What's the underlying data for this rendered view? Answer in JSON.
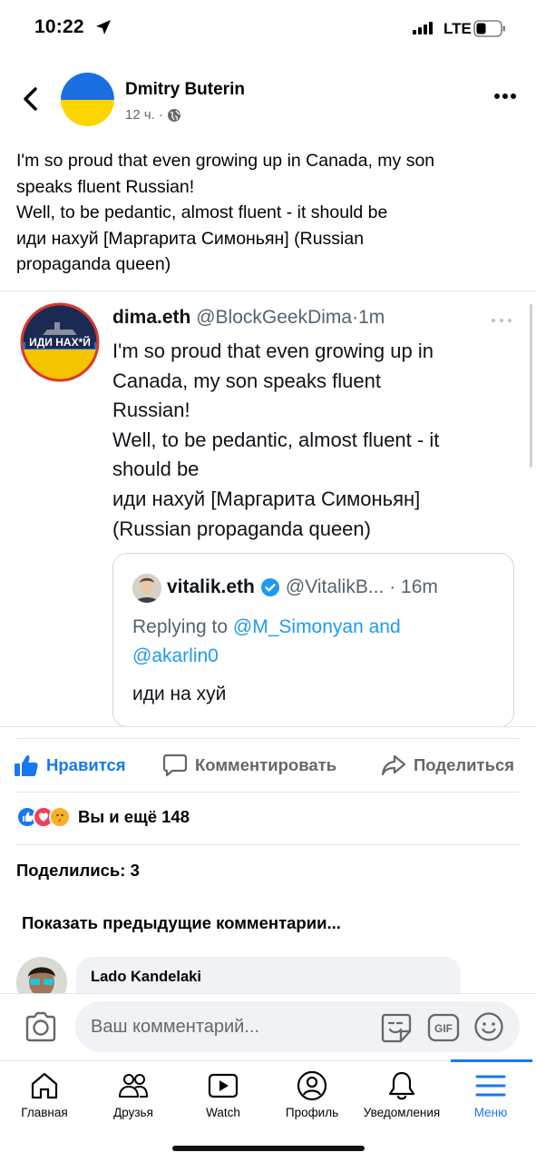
{
  "status_bar": {
    "time": "10:22",
    "network": "LTE",
    "icons": [
      "location-arrow-icon",
      "signal-bars-icon",
      "battery-icon"
    ]
  },
  "post": {
    "author": "Dmitry Buterin",
    "time": "12 ч.",
    "separator": "·",
    "avatar": "ukraine-flag",
    "lines": [
      "I'm so proud that even growing up in Canada, my son",
      "speaks fluent Russian!",
      "Well, to be pedantic, almost fluent - it should be",
      "иди нахуй [Маргарита Симоньян] (Russian",
      "propaganda queen)"
    ]
  },
  "tweet": {
    "name": "dima.eth",
    "handle": "@BlockGeekDima",
    "dot": "·",
    "time": "1m",
    "lines": [
      "I'm so proud that even growing up in",
      "Canada, my son speaks fluent",
      "Russian!",
      "Well, to be pedantic, almost fluent - it",
      "should be",
      "иди нахуй [Маргарита Симоньян]",
      "(Russian propaganda queen)"
    ],
    "avatar_text": "ИДИ НАХ*Й"
  },
  "quoted_tweet": {
    "name": "vitalik.eth",
    "handle": "@VitalikB...",
    "dot": "·",
    "time": "16m",
    "replying_prefix": "Replying to",
    "mention_1": "@M_Simonyan",
    "conj": "and",
    "mention_2": "@akarlin0",
    "text": "иди на хуй"
  },
  "actions": {
    "like": "Нравится",
    "comment": "Комментировать",
    "share": "Поделиться"
  },
  "reactions": {
    "text": "Вы и ещё 148",
    "icons": [
      "like-reaction-icon",
      "love-reaction-icon",
      "care-reaction-icon"
    ]
  },
  "shares": "Поделились: 3",
  "prev_comments": "Показать предыдущие комментарии...",
  "comment_preview": {
    "author": "Lado Kandelaki"
  },
  "composer": {
    "placeholder": "Ваш комментарий..."
  },
  "nav": [
    {
      "label": "Главная",
      "icon": "home-icon"
    },
    {
      "label": "Друзья",
      "icon": "friends-icon"
    },
    {
      "label": "Watch",
      "icon": "watch-icon"
    },
    {
      "label": "Профиль",
      "icon": "profile-icon"
    },
    {
      "label": "Уведомления",
      "icon": "bell-icon"
    },
    {
      "label": "Меню",
      "icon": "menu-icon"
    }
  ],
  "colors": {
    "accent": "#1877f2",
    "twitter_blue": "#1d9bf0",
    "ukraine_blue": "#1a6fe0",
    "ukraine_yellow": "#ffd500"
  }
}
